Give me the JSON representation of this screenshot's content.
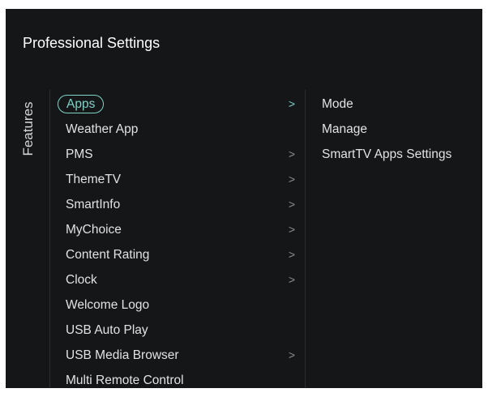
{
  "window": {
    "title": "Professional Settings"
  },
  "section_label": "Features",
  "menu": {
    "items": [
      {
        "label": "Apps",
        "has_submenu": true,
        "selected": true
      },
      {
        "label": "Weather App",
        "has_submenu": false
      },
      {
        "label": "PMS",
        "has_submenu": true
      },
      {
        "label": "ThemeTV",
        "has_submenu": true
      },
      {
        "label": "SmartInfo",
        "has_submenu": true
      },
      {
        "label": "MyChoice",
        "has_submenu": true
      },
      {
        "label": "Content Rating",
        "has_submenu": true
      },
      {
        "label": "Clock",
        "has_submenu": true
      },
      {
        "label": "Welcome Logo",
        "has_submenu": false
      },
      {
        "label": "USB Auto Play",
        "has_submenu": false
      },
      {
        "label": "USB Media Browser",
        "has_submenu": true
      },
      {
        "label": "Multi Remote Control",
        "has_submenu": false
      }
    ],
    "chevron": ">",
    "chevron_icon": "chevron-right-icon"
  },
  "submenu": {
    "items": [
      {
        "label": "Mode"
      },
      {
        "label": "Manage"
      },
      {
        "label": "SmartTV Apps Settings"
      }
    ]
  },
  "colors": {
    "background": "#141618",
    "accent": "#7fd3c7",
    "text": "#e2e2e2",
    "chevron": "#8e9196",
    "divider": "#2b2e31"
  }
}
